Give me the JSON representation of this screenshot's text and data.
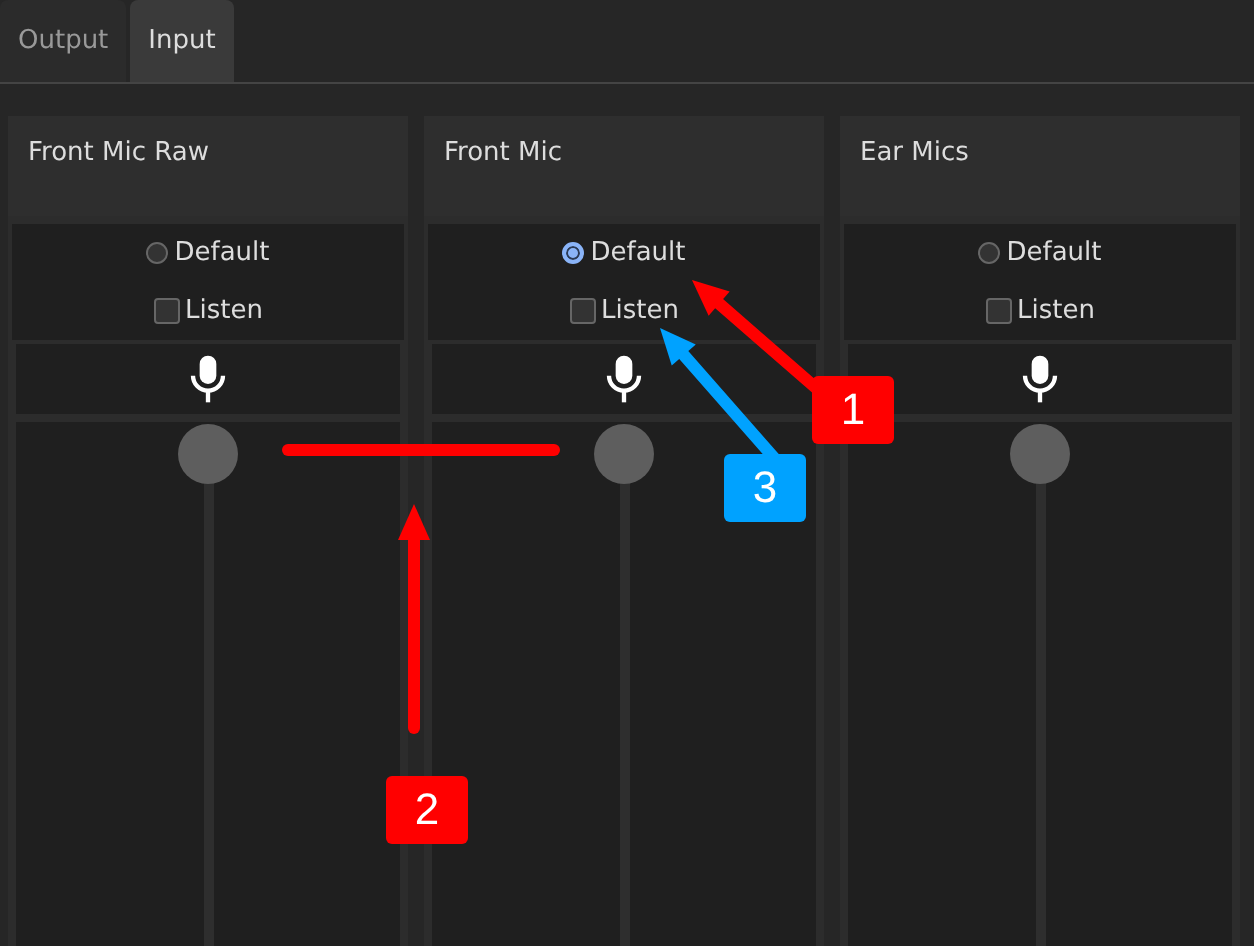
{
  "tabs": [
    {
      "label": "Output",
      "selected": false
    },
    {
      "label": "Input",
      "selected": true
    }
  ],
  "channels": [
    {
      "name": "Front Mic Raw",
      "default_label": "Default",
      "default_selected": false,
      "listen_label": "Listen",
      "listen_checked": false,
      "level": 1
    },
    {
      "name": "Front Mic",
      "default_label": "Default",
      "default_selected": true,
      "listen_label": "Listen",
      "listen_checked": false,
      "level": 1
    },
    {
      "name": "Ear Mics",
      "default_label": "Default",
      "default_selected": false,
      "listen_label": "Listen",
      "listen_checked": false,
      "level": 1
    }
  ],
  "annotations": [
    {
      "label": "1",
      "color": "#ff0000"
    },
    {
      "label": "2",
      "color": "#ff0000"
    },
    {
      "label": "3",
      "color": "#00a2ff"
    }
  ]
}
